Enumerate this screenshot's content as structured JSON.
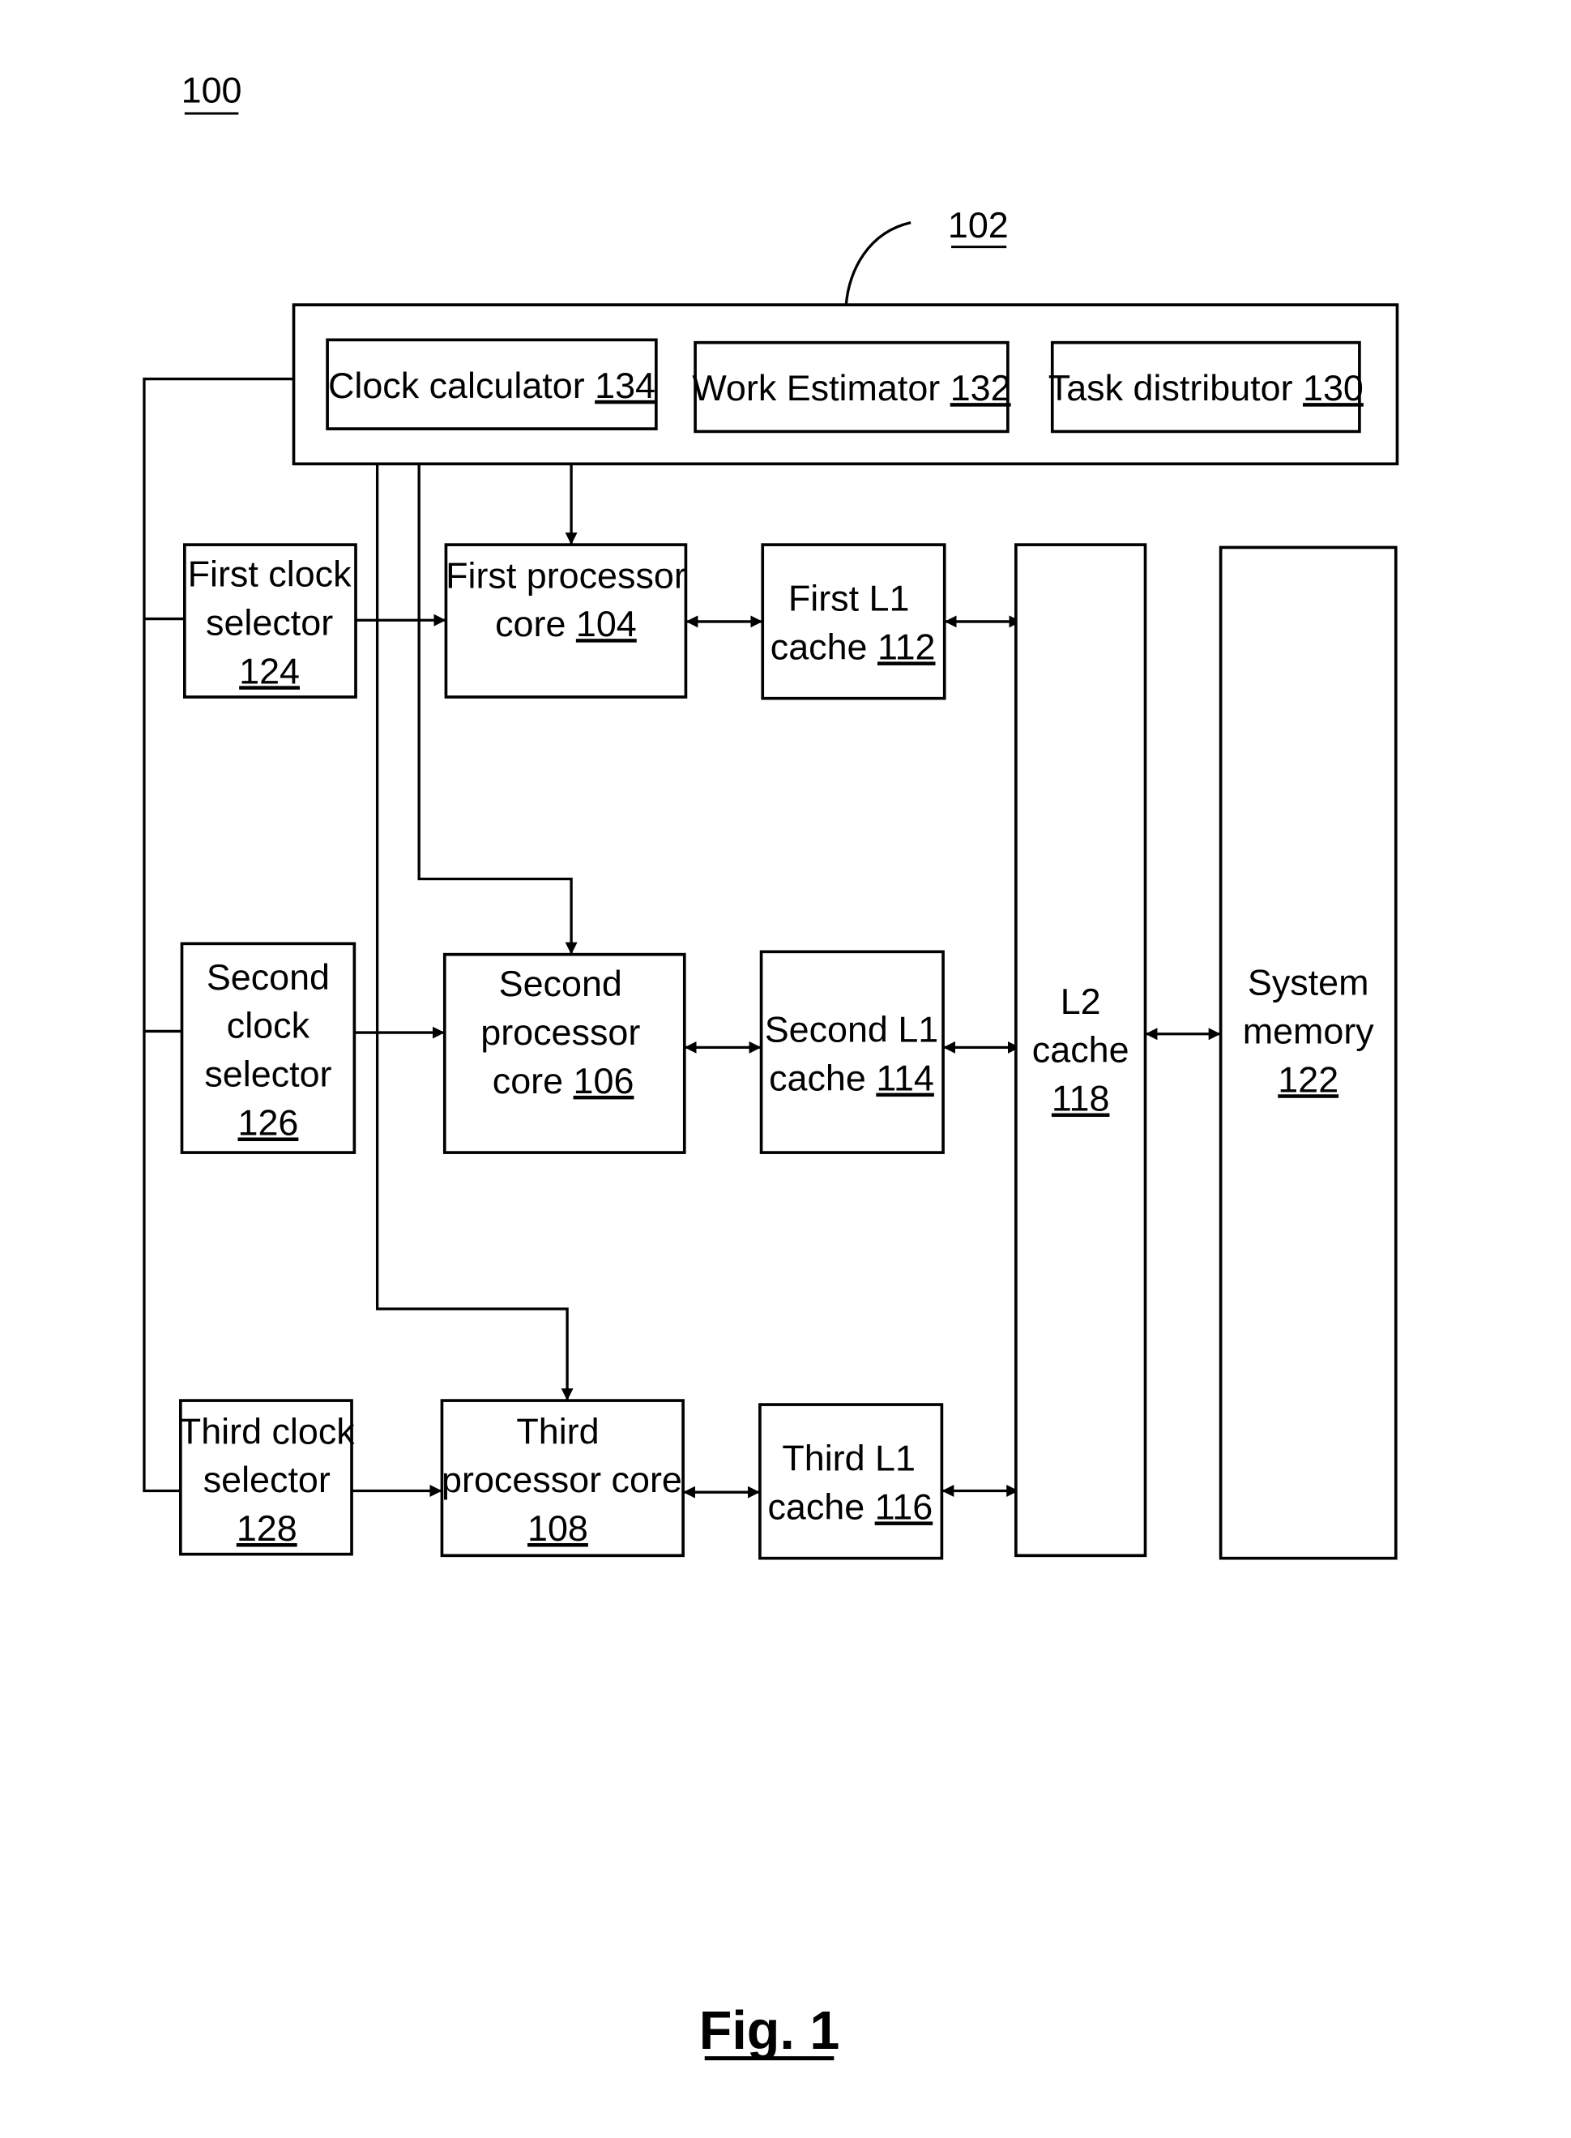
{
  "figure": {
    "ref_label": "100",
    "caption": "Fig. 1"
  },
  "controller": {
    "ref": "102",
    "components": [
      {
        "name": "Clock calculator",
        "ref": "134"
      },
      {
        "name": "Work Estimator",
        "ref": "132"
      },
      {
        "name": "Task distributor",
        "ref": "130"
      }
    ]
  },
  "clock_selectors": [
    {
      "lines": [
        "First clock",
        "selector"
      ],
      "ref": "124"
    },
    {
      "lines": [
        "Second",
        "clock",
        "selector"
      ],
      "ref": "126"
    },
    {
      "lines": [
        "Third clock",
        "selector"
      ],
      "ref": "128"
    }
  ],
  "processor_cores": [
    {
      "lines": [
        "First processor",
        "core"
      ],
      "ref": "104"
    },
    {
      "lines": [
        "Second",
        "processor",
        "core"
      ],
      "ref": "106"
    },
    {
      "lines": [
        "Third",
        "processor core"
      ],
      "ref": "108"
    }
  ],
  "l1_caches": [
    {
      "lines": [
        "First L1",
        "cache"
      ],
      "ref": "112"
    },
    {
      "lines": [
        "Second L1",
        "cache"
      ],
      "ref": "114"
    },
    {
      "lines": [
        "Third L1",
        "cache"
      ],
      "ref": "116"
    }
  ],
  "l2_cache": {
    "lines": [
      "L2",
      "cache"
    ],
    "ref": "118"
  },
  "system_memory": {
    "lines": [
      "System",
      "memory"
    ],
    "ref": "122"
  }
}
